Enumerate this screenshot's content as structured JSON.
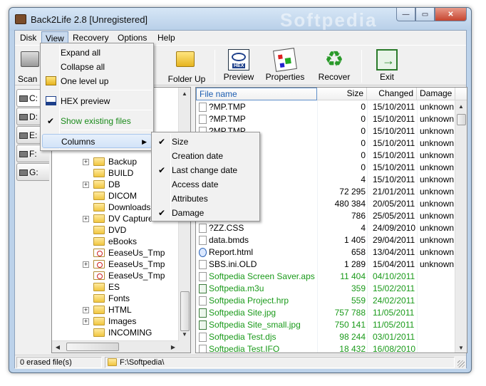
{
  "window": {
    "title": "Back2Life 2.8 [Unregistered]",
    "watermark": "Softpedia"
  },
  "caption_buttons": {
    "minimize": "—",
    "maximize": "▭",
    "close": "✕"
  },
  "menubar": [
    "Disk",
    "View",
    "Recovery",
    "Options",
    "Help"
  ],
  "toolbar": {
    "scan": "Scan F",
    "folder_up": "Folder Up",
    "preview": "Preview",
    "preview_badge": "HEX",
    "properties": "Properties",
    "recover": "Recover",
    "exit": "Exit"
  },
  "drives": [
    "C:",
    "D:",
    "E:",
    "F:",
    "G:"
  ],
  "tree": [
    {
      "name": "Backup",
      "expandable": true,
      "icon": "folder"
    },
    {
      "name": "BUILD",
      "expandable": false,
      "icon": "folder"
    },
    {
      "name": "DB",
      "expandable": true,
      "icon": "folder"
    },
    {
      "name": "DICOM",
      "expandable": false,
      "icon": "folder"
    },
    {
      "name": "Downloads",
      "expandable": false,
      "icon": "folder"
    },
    {
      "name": "DV Capture",
      "expandable": true,
      "icon": "folder"
    },
    {
      "name": "DVD",
      "expandable": false,
      "icon": "folder"
    },
    {
      "name": "eBooks",
      "expandable": false,
      "icon": "folder"
    },
    {
      "name": "EeaseUs_Tmp",
      "expandable": false,
      "icon": "folder-deleted"
    },
    {
      "name": "EeaseUs_Tmp",
      "expandable": true,
      "icon": "folder-deleted"
    },
    {
      "name": "EeaseUs_Tmp",
      "expandable": false,
      "icon": "folder-deleted"
    },
    {
      "name": "ES",
      "expandable": false,
      "icon": "folder"
    },
    {
      "name": "Fonts",
      "expandable": false,
      "icon": "folder"
    },
    {
      "name": "HTML",
      "expandable": true,
      "icon": "folder"
    },
    {
      "name": "Images",
      "expandable": true,
      "icon": "folder"
    },
    {
      "name": "INCOMING",
      "expandable": false,
      "icon": "folder"
    }
  ],
  "list": {
    "columns": {
      "name": "File name",
      "size": "Size",
      "changed": "Changed",
      "damage": "Damage"
    },
    "rows": [
      {
        "name": "?MP.TMP",
        "size": "0",
        "changed": "15/10/2011",
        "damage": "unknown",
        "icon": "file",
        "green": false
      },
      {
        "name": "?MP.TMP",
        "size": "0",
        "changed": "15/10/2011",
        "damage": "unknown",
        "icon": "file",
        "green": false
      },
      {
        "name": "?MP.TMP",
        "size": "0",
        "changed": "15/10/2011",
        "damage": "unknown",
        "icon": "file",
        "green": false
      },
      {
        "name": "",
        "size": "0",
        "changed": "15/10/2011",
        "damage": "unknown",
        "icon": "file",
        "green": false
      },
      {
        "name": "",
        "size": "0",
        "changed": "15/10/2011",
        "damage": "unknown",
        "icon": "file",
        "green": false
      },
      {
        "name": "",
        "size": "0",
        "changed": "15/10/2011",
        "damage": "unknown",
        "icon": "file",
        "green": false
      },
      {
        "name": "",
        "size": "4",
        "changed": "15/10/2011",
        "damage": "unknown",
        "icon": "file",
        "green": false
      },
      {
        "name": "",
        "size": "72 295",
        "changed": "21/01/2011",
        "damage": "unknown",
        "icon": "file",
        "green": false
      },
      {
        "name": "",
        "size": "480 384",
        "changed": "20/05/2011",
        "damage": "unknown",
        "icon": "file",
        "green": false
      },
      {
        "name": "",
        "size": "786",
        "changed": "25/05/2011",
        "damage": "unknown",
        "icon": "file",
        "green": false
      },
      {
        "name": "?ZZ.CSS",
        "size": "4",
        "changed": "24/09/2010",
        "damage": "unknown",
        "icon": "file",
        "green": false
      },
      {
        "name": "data.bmds",
        "size": "1 405",
        "changed": "29/04/2011",
        "damage": "unknown",
        "icon": "file",
        "green": false
      },
      {
        "name": "Report.html",
        "size": "658",
        "changed": "13/04/2011",
        "damage": "unknown",
        "icon": "web",
        "green": false
      },
      {
        "name": "SBS.ini.OLD",
        "size": "1 289",
        "changed": "15/04/2011",
        "damage": "unknown",
        "icon": "file",
        "green": false
      },
      {
        "name": "Softpedia Screen Saver.aps",
        "size": "11 404",
        "changed": "04/10/2011",
        "damage": "",
        "icon": "file",
        "green": true
      },
      {
        "name": "Softpedia.m3u",
        "size": "359",
        "changed": "15/02/2011",
        "damage": "",
        "icon": "img",
        "green": true
      },
      {
        "name": "Softpedia Project.hrp",
        "size": "559",
        "changed": "24/02/2011",
        "damage": "",
        "icon": "file",
        "green": true
      },
      {
        "name": "Softpedia Site.jpg",
        "size": "757 788",
        "changed": "11/05/2011",
        "damage": "",
        "icon": "img",
        "green": true
      },
      {
        "name": "Softpedia Site_small.jpg",
        "size": "750 141",
        "changed": "11/05/2011",
        "damage": "",
        "icon": "img",
        "green": true
      },
      {
        "name": "Softpedia Test.djs",
        "size": "98 244",
        "changed": "03/01/2011",
        "damage": "",
        "icon": "file",
        "green": true
      },
      {
        "name": "Softpedia Test.IFO",
        "size": "18 432",
        "changed": "16/08/2010",
        "damage": "",
        "icon": "file",
        "green": true
      }
    ]
  },
  "view_menu": [
    {
      "label": "Expand all",
      "checked": false,
      "icon": ""
    },
    {
      "label": "Collapse all",
      "checked": false,
      "icon": ""
    },
    {
      "label": "One level up",
      "checked": false,
      "icon": "folder-up-icon"
    },
    {
      "label": "HEX preview",
      "checked": false,
      "icon": "hex-icon"
    },
    {
      "label": "Show existing files",
      "checked": true,
      "icon": ""
    },
    {
      "label": "Columns",
      "checked": false,
      "icon": "",
      "submenu": true
    }
  ],
  "columns_menu": [
    {
      "label": "Size",
      "checked": true
    },
    {
      "label": "Creation date",
      "checked": false
    },
    {
      "label": "Last change date",
      "checked": true
    },
    {
      "label": "Access date",
      "checked": false
    },
    {
      "label": "Attributes",
      "checked": false
    },
    {
      "label": "Damage",
      "checked": true
    }
  ],
  "status": {
    "count": "0  erased file(s)",
    "path": "F:\\Softpedia\\"
  },
  "colors": {
    "green_text": "#1a9a1a",
    "menu_highlight": "#d2e3f8",
    "title_bar": "#c6daef"
  }
}
